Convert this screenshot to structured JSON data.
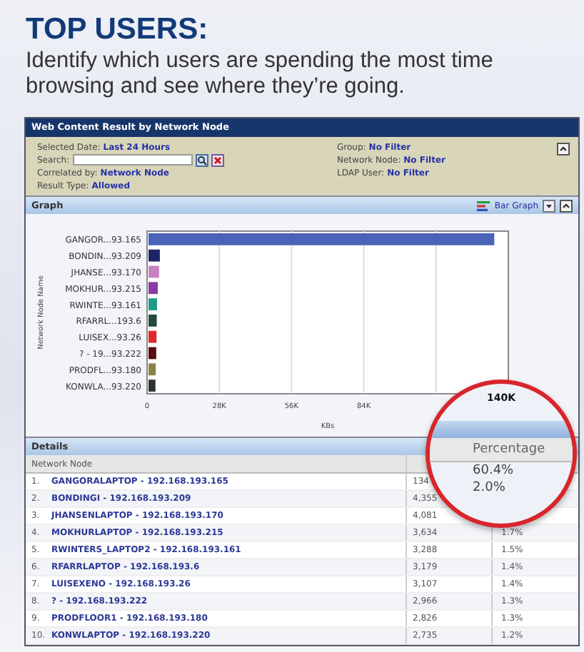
{
  "heading": {
    "title": "TOP USERS:",
    "subtitle": "Identify which users are spending the most time browsing and see where they’re going."
  },
  "window": {
    "title": "Web Content Result by Network Node"
  },
  "filters": {
    "left": [
      {
        "label": "Selected Date:",
        "value": "Last 24 Hours",
        "kind": "text"
      },
      {
        "label": "Search:",
        "kind": "search"
      },
      {
        "label": "Correlated by:",
        "value": "Network Node",
        "kind": "text"
      },
      {
        "label": "Result Type:",
        "value": "Allowed",
        "kind": "text"
      }
    ],
    "right": [
      {
        "label": "Group:",
        "value": "No Filter"
      },
      {
        "label": "Network Node:",
        "value": "No Filter"
      },
      {
        "label": "LDAP User:",
        "value": "No Filter"
      }
    ]
  },
  "graph": {
    "title": "Graph",
    "view": "Bar Graph",
    "chart_data": {
      "type": "bar",
      "orientation": "horizontal",
      "xlabel": "KBs",
      "ylabel": "Network Node Name",
      "categories": [
        "GANGOR...93.165",
        "BONDIN...93.209",
        "JHANSE...93.170",
        "MOKHUR...93.215",
        "RWINTE...93.161",
        "RFARRL...193.6",
        "LUISEX...93.26",
        "? - 19...93.222",
        "PRODFL...93.180",
        "KONWLA...93.220"
      ],
      "series": [
        {
          "values": [
            134000,
            4400,
            4100,
            3600,
            3300,
            3200,
            3100,
            3000,
            2800,
            2700
          ]
        }
      ],
      "grid": true,
      "colors": [
        "#4a63b8",
        "#1c2466",
        "#c882c0",
        "#8a3aa0",
        "#1f9a8a",
        "#244a3e",
        "#e02a2a",
        "#5a0c12",
        "#8a8444",
        "#2e3436"
      ],
      "xlim": [
        0,
        140000
      ],
      "xticks": [
        {
          "value": 0,
          "label": "0"
        },
        {
          "value": 28000,
          "label": "28K"
        },
        {
          "value": 56000,
          "label": "56K"
        },
        {
          "value": 84000,
          "label": "84K"
        }
      ]
    }
  },
  "details": {
    "title": "Details",
    "columns": [
      "Network Node"
    ],
    "rows": [
      {
        "rank": "1.",
        "node": "GANGORALAPTOP - 192.168.193.165",
        "column_2": "134"
      },
      {
        "rank": "2.",
        "node": "BONDINGI - 192.168.193.209",
        "column_2": "4,355"
      },
      {
        "rank": "3.",
        "node": "JHANSENLAPTOP - 192.168.193.170",
        "column_2": "4,081"
      },
      {
        "rank": "4.",
        "node": "MOKHURLAPTOP - 192.168.193.215",
        "column_2": "3,634",
        "percentage": "1.7%"
      },
      {
        "rank": "5.",
        "node": "RWINTERS_LAPTOP2 - 192.168.193.161",
        "column_2": "3,288",
        "percentage": "1.5%"
      },
      {
        "rank": "6.",
        "node": "RFARRLAPTOP - 192.168.193.6",
        "column_2": "3,179",
        "percentage": "1.4%"
      },
      {
        "rank": "7.",
        "node": "LUISEXENO - 192.168.193.26",
        "column_2": "3,107",
        "percentage": "1.4%"
      },
      {
        "rank": "8.",
        "node": "? - 192.168.193.222",
        "column_2": "2,966",
        "percentage": "1.3%"
      },
      {
        "rank": "9.",
        "node": "PRODFLOOR1 - 192.168.193.180",
        "column_2": "2,826",
        "percentage": "1.3%"
      },
      {
        "rank": "10.",
        "node": "KONWLAPTOP - 192.168.193.220",
        "column_2": "2,735",
        "percentage": "1.2%"
      }
    ]
  },
  "magnifier": {
    "tick": "140K",
    "header": "Percentage",
    "values": [
      "60.4%",
      "2.0%"
    ]
  }
}
